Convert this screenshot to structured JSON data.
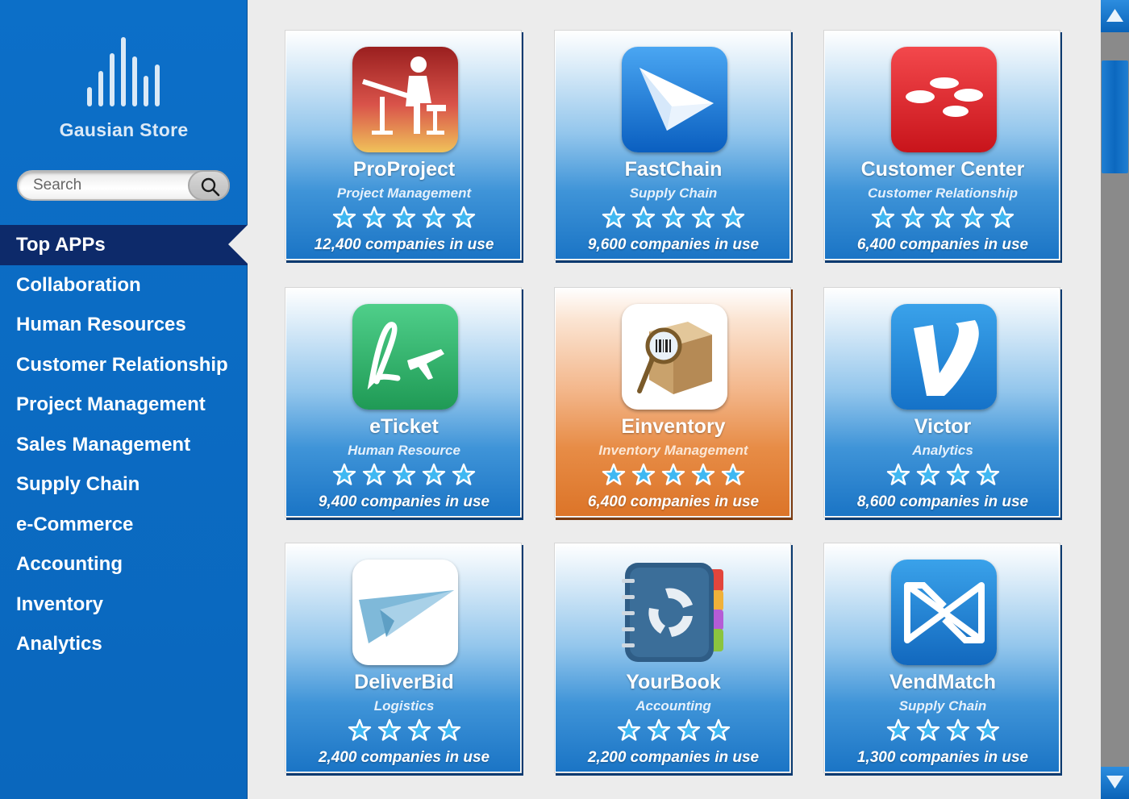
{
  "store": {
    "name": "Gausian Store"
  },
  "search": {
    "placeholder": "Search"
  },
  "nav": {
    "items": [
      {
        "label": "Top APPs",
        "active": true
      },
      {
        "label": "Collaboration",
        "active": false
      },
      {
        "label": "Human Resources",
        "active": false
      },
      {
        "label": "Customer Relationship",
        "active": false
      },
      {
        "label": "Project Management",
        "active": false
      },
      {
        "label": "Sales Management",
        "active": false
      },
      {
        "label": "Supply Chain",
        "active": false
      },
      {
        "label": "e-Commerce",
        "active": false
      },
      {
        "label": "Accounting",
        "active": false
      },
      {
        "label": "Inventory",
        "active": false
      },
      {
        "label": "Analytics",
        "active": false
      }
    ]
  },
  "apps": [
    {
      "name": "ProProject",
      "category": "Project Management",
      "stars": 5,
      "usage": "12,400 companies in use",
      "icon": "drafting-desk-icon",
      "highlighted": false
    },
    {
      "name": "FastChain",
      "category": "Supply Chain",
      "stars": 5,
      "usage": "9,600 companies in use",
      "icon": "paper-plane-icon",
      "highlighted": false
    },
    {
      "name": "Customer Center",
      "category": "Customer Relationship",
      "stars": 5,
      "usage": "6,400 companies in use",
      "icon": "discs-icon",
      "highlighted": false
    },
    {
      "name": "eTicket",
      "category": "Human Resource",
      "stars": 5,
      "usage": "9,400 companies in use",
      "icon": "flight-ticket-icon",
      "highlighted": false
    },
    {
      "name": "Einventory",
      "category": "Inventory Management",
      "stars": 5,
      "usage": "6,400 companies in use",
      "icon": "box-magnifier-icon",
      "highlighted": true
    },
    {
      "name": "Victor",
      "category": "Analytics",
      "stars": 4,
      "usage": "8,600 companies in use",
      "icon": "v-letter-icon",
      "highlighted": false
    },
    {
      "name": "DeliverBid",
      "category": "Logistics",
      "stars": 4,
      "usage": "2,400 companies in use",
      "icon": "paper-plane-outline-icon",
      "highlighted": false
    },
    {
      "name": "YourBook",
      "category": "Accounting",
      "stars": 4,
      "usage": "2,200 companies in use",
      "icon": "address-book-icon",
      "highlighted": false
    },
    {
      "name": "VendMatch",
      "category": "Supply Chain",
      "stars": 4,
      "usage": "1,300 companies in use",
      "icon": "bowtie-icon",
      "highlighted": false
    }
  ],
  "colors": {
    "sidebar": "#0a6bc2",
    "nav_active": "#0d2a6a",
    "card_blue": "#1a74c5",
    "card_orange": "#dc7428",
    "star": "#3fb8f2"
  }
}
